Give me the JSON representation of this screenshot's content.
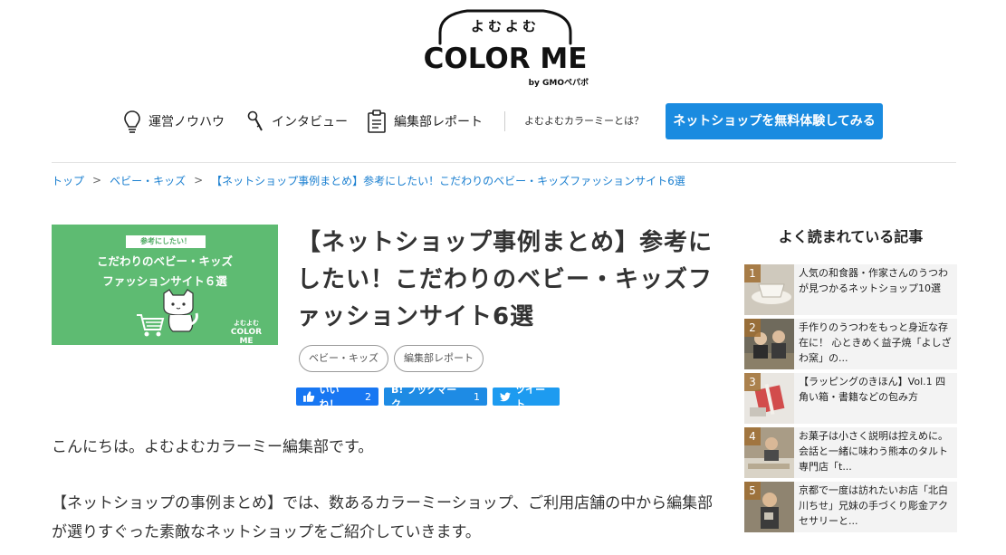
{
  "header": {
    "logo_top": "よむよむ",
    "logo_title": "COLOR ME",
    "logo_by": "by GMOペパボ",
    "nav": [
      {
        "label": "運営ノウハウ",
        "icon": "lightbulb-icon"
      },
      {
        "label": "インタビュー",
        "icon": "microphone-icon"
      },
      {
        "label": "編集部レポート",
        "icon": "clipboard-icon"
      }
    ],
    "about": "よむよむカラーミーとは？",
    "cta": "ネットショップを無料体験してみる"
  },
  "breadcrumb": {
    "items": [
      "トップ",
      "ベビー・キッズ",
      "【ネットショップ事例まとめ】参考にしたい！こだわりのベビー・キッズファッションサイト6選"
    ],
    "separator": ">"
  },
  "thumbnail": {
    "tag": "参考にしたい！",
    "line1": "こだわりのベビー・キッズ",
    "line2": "ファッションサイト６選",
    "logo_top": "よむよむ",
    "logo": "COLOR ME",
    "bg_color": "#5ebb72"
  },
  "article": {
    "title": "【ネットショップ事例まとめ】参考にしたい！こだわりのベビー・キッズファッションサイト6選",
    "tags": [
      "ベビー・キッズ",
      "編集部レポート"
    ],
    "social": {
      "like_label": "いいね！",
      "like_count": "2",
      "hatena_label": "B! ブックマーク",
      "hatena_count": "1",
      "tweet_label": "ツイート"
    },
    "paragraphs": [
      "こんにちは。よむよむカラーミー編集部です。",
      "【ネットショップの事例まとめ】では、数あるカラーミーショップ、ご利用店舗の中から編集部が選りすぐった素敵なネットショップをご紹介していきます。"
    ]
  },
  "sidebar": {
    "heading": "よく読まれている記事",
    "ranking": [
      {
        "num": "1",
        "text": "人気の和食器・作家さんのうつわが見つかるネットショップ10選"
      },
      {
        "num": "2",
        "text": "手作りのうつわをもっと身近な存在に！ 心ときめく益子焼「よしざわ窯」の..."
      },
      {
        "num": "3",
        "text": "【ラッピングのきほん】Vol.1 四角い箱・書籍などの包み方"
      },
      {
        "num": "4",
        "text": "お菓子は小さく説明は控えめに。会話と一緒に味わう熊本のタルト専門店「t..."
      },
      {
        "num": "5",
        "text": "京都で一度は訪れたいお店「北白川ちせ」兄妹の手づくり彫金アクセサリーと..."
      }
    ]
  },
  "colors": {
    "accent": "#1a8be0",
    "link": "#1a7fd0"
  }
}
